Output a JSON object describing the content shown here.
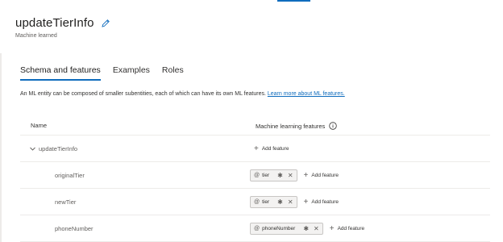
{
  "header": {
    "title": "updateTierInfo",
    "subtitle": "Machine learned"
  },
  "tabs": [
    {
      "label": "Schema and features",
      "active": true
    },
    {
      "label": "Examples",
      "active": false
    },
    {
      "label": "Roles",
      "active": false
    }
  ],
  "intro": {
    "text": "An ML entity can be composed of smaller subentities, each of which can have its own ML features. ",
    "link": "Learn more about ML features."
  },
  "table": {
    "col_name": "Name",
    "col_features": "Machine learning features",
    "root": {
      "name": "updateTierInfo",
      "add_label": "Add feature"
    },
    "children": [
      {
        "name": "originalTier",
        "chip": "tier",
        "add_label": "Add feature"
      },
      {
        "name": "newTier",
        "chip": "tier",
        "add_label": "Add feature"
      },
      {
        "name": "phoneNumber",
        "chip": "phoneNumber",
        "add_label": "Add feature"
      }
    ]
  },
  "glyphs": {
    "at": "@",
    "required": "✱",
    "remove": "✕",
    "plus": "+"
  },
  "colors": {
    "accent": "#0f6cbd",
    "text": "#323130",
    "muted": "#605e5c",
    "border": "#edebe9"
  }
}
